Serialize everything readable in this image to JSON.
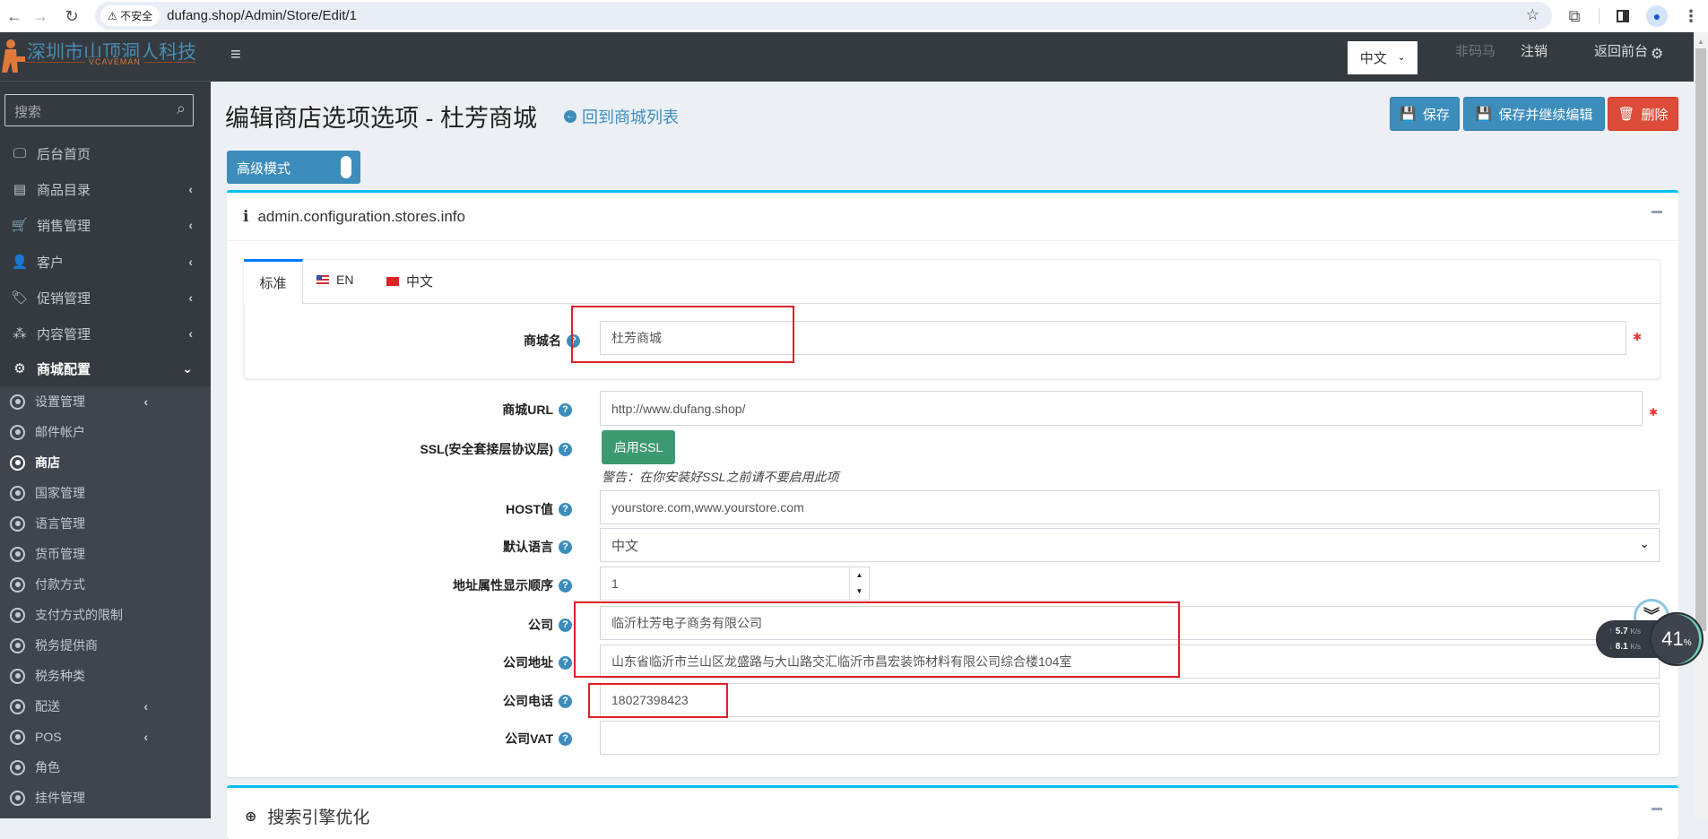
{
  "browser": {
    "security_label": "不安全",
    "url": "dufang.shop/Admin/Store/Edit/1"
  },
  "logo": {
    "text": "深圳市山顶洞人科技",
    "sub": "VCAVEMAN"
  },
  "sidebar": {
    "search_placeholder": "搜索",
    "items": [
      {
        "label": "后台首页"
      },
      {
        "label": "商品目录"
      },
      {
        "label": "销售管理"
      },
      {
        "label": "客户"
      },
      {
        "label": "促销管理"
      },
      {
        "label": "内容管理"
      },
      {
        "label": "商城配置"
      }
    ],
    "subitems": [
      {
        "label": "设置管理"
      },
      {
        "label": "邮件帐户"
      },
      {
        "label": "商店"
      },
      {
        "label": "国家管理"
      },
      {
        "label": "语言管理"
      },
      {
        "label": "货币管理"
      },
      {
        "label": "付款方式"
      },
      {
        "label": "支付方式的限制"
      },
      {
        "label": "税务提供商"
      },
      {
        "label": "税务种类"
      },
      {
        "label": "配送"
      },
      {
        "label": "POS"
      },
      {
        "label": "角色"
      },
      {
        "label": "挂件管理"
      }
    ]
  },
  "topbar": {
    "language": "中文",
    "user": "非码马",
    "logout": "注销",
    "frontend": "返回前台"
  },
  "page": {
    "title": "编辑商店选项选项 - 杜芳商城",
    "back_link": "回到商城列表",
    "save": "保存",
    "save_continue": "保存并继续编辑",
    "delete": "删除",
    "advanced_mode": "高级模式"
  },
  "box": {
    "title": "admin.configuration.stores.info",
    "tabs": [
      "标准",
      "EN",
      "中文"
    ]
  },
  "form": {
    "store_name": {
      "label": "商城名",
      "value": "杜芳商城"
    },
    "store_url": {
      "label": "商城URL",
      "value": "http://www.dufang.shop/"
    },
    "ssl": {
      "label": "SSL(安全套接层协议层)",
      "button": "启用SSL",
      "warning": "警告：在你安装好SSL之前请不要启用此项"
    },
    "host": {
      "label": "HOST值",
      "value": "yourstore.com,www.yourstore.com"
    },
    "language": {
      "label": "默认语言",
      "value": "中文"
    },
    "address_order": {
      "label": "地址属性显示顺序",
      "value": "1"
    },
    "company": {
      "label": "公司",
      "value": "临沂杜芳电子商务有限公司"
    },
    "company_address": {
      "label": "公司地址",
      "value": "山东省临沂市兰山区龙盛路与大山路交汇临沂市昌宏装饰材料有限公司综合楼104室"
    },
    "company_phone": {
      "label": "公司电话",
      "value": "18027398423"
    },
    "company_vat": {
      "label": "公司VAT",
      "value": ""
    }
  },
  "seo_box": {
    "title": "搜索引擎优化"
  },
  "net_widget": {
    "up": "5.7",
    "down": "8.1",
    "unit": "K/s",
    "percent": "41",
    "percent_sign": "%"
  }
}
